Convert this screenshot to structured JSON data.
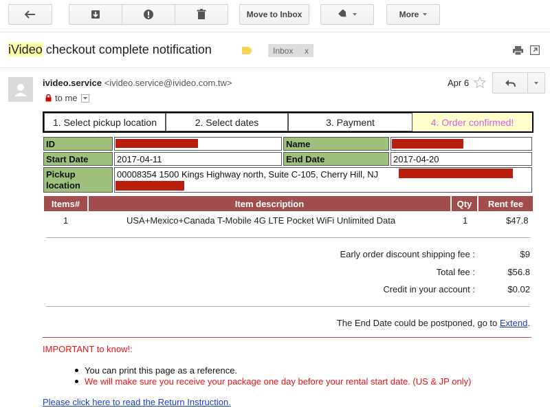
{
  "toolbar": {
    "back_icon": "arrow-left-icon",
    "archive_icon": "archive-icon",
    "spam_icon": "report-spam-icon",
    "delete_icon": "trash-icon",
    "move_to_inbox_label": "Move to Inbox",
    "labels_icon": "label-tag-icon",
    "more_label": "More"
  },
  "email": {
    "subject_highlight": "iVideo",
    "subject_rest": " checkout complete notification",
    "inbox_tag": "Inbox",
    "inbox_tag_close": "x",
    "sender_name": "ivideo.service",
    "sender_address": "<ivideo.service@ivideo.com.tw>",
    "to_me": "to me",
    "date": "Apr 6"
  },
  "steps": [
    "1. Select pickup location",
    "2. Select dates",
    "3. Payment",
    "4. Order confirmed!"
  ],
  "info": {
    "id_label": "ID",
    "name_label": "Name",
    "start_label": "Start Date",
    "start_value": "2017-04-11",
    "end_label": "End Date",
    "end_value": "2017-04-20",
    "pickup_label_1": "Pickup",
    "pickup_label_2": "location",
    "pickup_value": "00008354 1500 Kings Highway north, Suite C-105, Cherry Hill, NJ"
  },
  "items": {
    "headers": [
      "Items#",
      "Item description",
      "Qty",
      "Rent fee"
    ],
    "rows": [
      {
        "num": "1",
        "desc": "USA+Mexico+Canada T-Mobile 4G LTE Pocket WiFi Unlimited Data",
        "qty": "1",
        "fee": "$47.8"
      }
    ]
  },
  "fees": {
    "shipping_label": "Early order discount shipping fee :",
    "shipping_value": "$9",
    "total_label": "Total fee :",
    "total_value": "$56.8",
    "credit_label": "Credit in your account :",
    "credit_value": "$0.02"
  },
  "postpone": {
    "text": "The End Date could be postponed, go to ",
    "link": "Extend",
    "period": "."
  },
  "important": {
    "title": "IMPORTANT to know!:",
    "bullet1": "You can print this page as a reference.",
    "bullet2": "We will make sure you receive your package one day before your rental start date. (US & JP only)",
    "return_link": "Please click here to read the Return Instruction."
  },
  "colors": {
    "redaction": "#b81f0e",
    "label_green": "#9fc07d",
    "header_red": "#a24d4d",
    "confirmed_magenta": "#e05ce0",
    "important_red": "#e11111",
    "link_blue": "#1a3fcc"
  }
}
